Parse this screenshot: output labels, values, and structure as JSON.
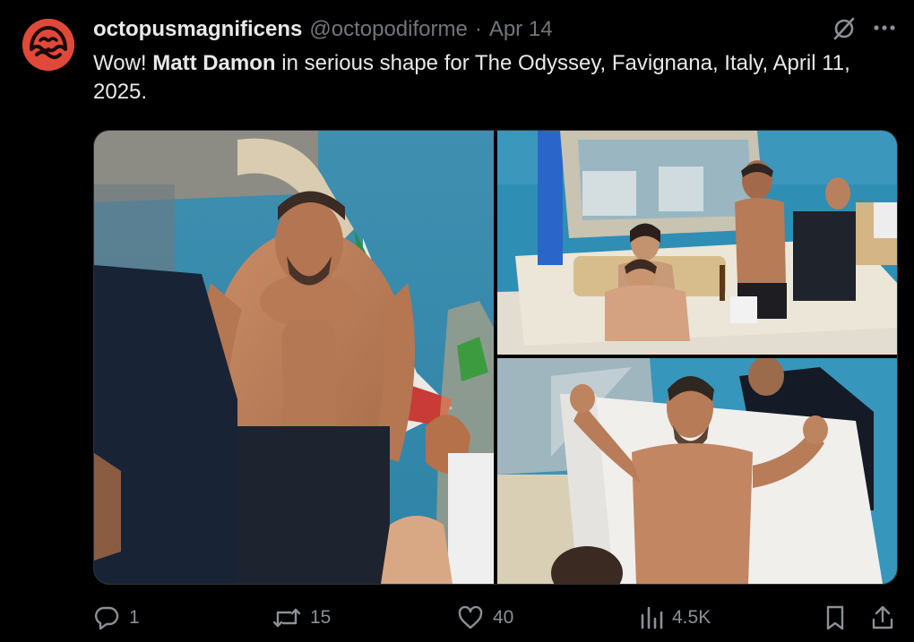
{
  "post": {
    "display_name": "octopusmagnificens",
    "handle": "@octopodiforme",
    "separator": "·",
    "date": "Apr 14",
    "text_before": "Wow! ",
    "text_bold": "Matt Damon",
    "text_after": " in serious shape for The Odyssey, Favignana, Italy, April 11, 2025."
  },
  "icons": {
    "avatar": "octopus-avatar-icon",
    "grok": "grok-icon",
    "more": "more-icon",
    "reply": "reply-icon",
    "repost": "repost-icon",
    "like": "like-icon",
    "views": "views-icon",
    "bookmark": "bookmark-icon",
    "share": "share-icon"
  },
  "stats": {
    "replies": "1",
    "reposts": "15",
    "likes": "40",
    "views": "4.5K"
  },
  "colors": {
    "background": "#000000",
    "text": "#e7e9ea",
    "muted": "#71767b",
    "avatar": "#e0493a"
  }
}
